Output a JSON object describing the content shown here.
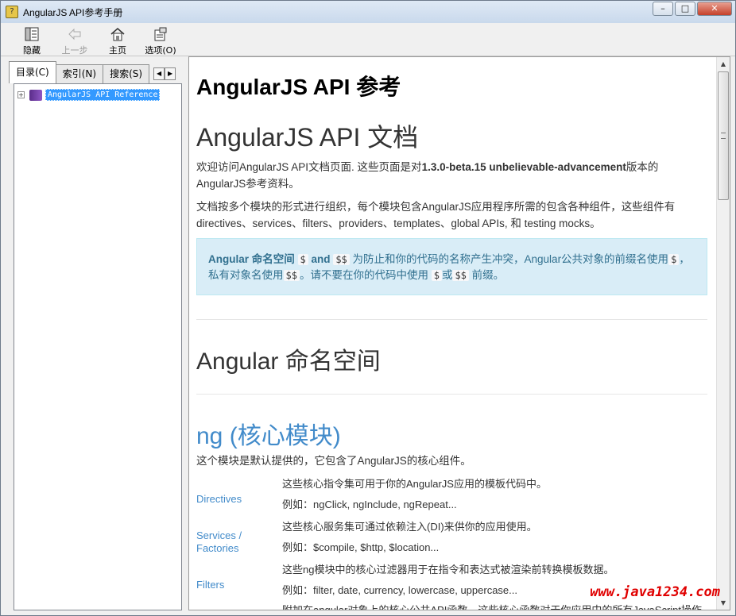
{
  "window": {
    "title": "AngularJS API参考手册",
    "minimize": "–",
    "maximize": "□",
    "close": "✕"
  },
  "toolbar": {
    "hide_label": "隐藏",
    "back_label": "上一步",
    "home_label": "主页",
    "options_label": "选项(O)"
  },
  "left_pane": {
    "tabs": [
      "目录(C)",
      "索引(N)",
      "搜索(S)"
    ],
    "tab_arrow_left": "◀",
    "tab_arrow_right": "▶",
    "tree": {
      "expander": "+",
      "label": "AngularJS API Reference"
    }
  },
  "content": {
    "page_title": "AngularJS API 参考",
    "doc_title": "AngularJS API 文档",
    "intro_1a": "欢迎访问AngularJS API文档页面. 这些页面是对",
    "intro_1b": "1.3.0-beta.15 unbelievable-advancement",
    "intro_1c": "版本的AngularJS参考资料。",
    "intro_2": "文档按多个模块的形式进行组织，每个模块包含AngularJS应用程序所需的包含各种组件，这些组件有directives、services、filters、providers、templates、global APIs, 和  testing mocks。",
    "notice": {
      "strong": "Angular 命名空间",
      "code1": "$",
      "and": "and",
      "code2": "$$",
      "text1": "为防止和你的代码的名称产生冲突，Angular公共对象的前缀名使用",
      "code3": "$",
      "text2": "，私有对象名使用",
      "code4": "$$",
      "text3": "。请不要在你的代码中使用",
      "code5": "$",
      "text4": "或",
      "code6": "$$",
      "text5": "前缀。"
    },
    "section_title": "Angular 命名空间",
    "ng_title": "ng (核心模块)",
    "ng_desc": "这个模块是默认提供的，它包含了AngularJS的核心组件。",
    "modules": [
      {
        "name": "Directives",
        "desc": "这些核心指令集可用于你的AngularJS应用的模板代码中。",
        "example": "例如：ngClick, ngInclude, ngRepeat..."
      },
      {
        "name": "Services / Factories",
        "desc": "这些核心服务集可通过依赖注入(DI)来供你的应用使用。",
        "example": "例如：$compile, $http, $location..."
      },
      {
        "name": "Filters",
        "desc": "这些ng模块中的核心过滤器用于在指令和表达式被渲染前转换模板数据。",
        "example": "例如：filter, date, currency, lowercase, uppercase..."
      }
    ],
    "partial_line": "附加在angular对象上的核心公共API函数，这些核心函数对于你应用中的所有JavaScript操作"
  },
  "scrollbar": {
    "up": "▲",
    "down": "▼"
  },
  "watermark": "www.java1234.com",
  "colors": {
    "link_blue": "#428bca",
    "notice_bg": "#d9edf7",
    "notice_text": "#31708f",
    "selection": "#3399ff",
    "watermark": "#e00000"
  }
}
